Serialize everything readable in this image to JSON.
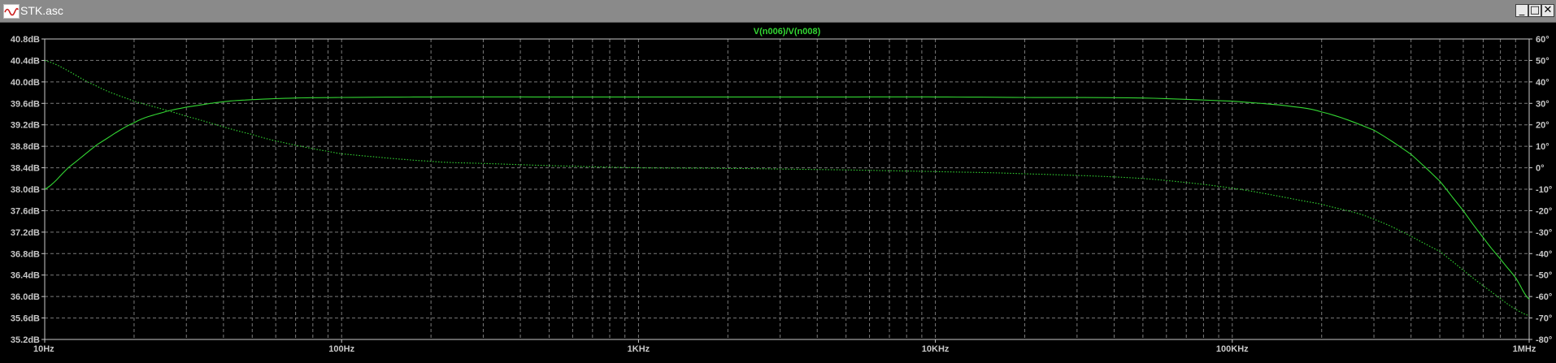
{
  "window": {
    "title": "STK.asc",
    "minimize_symbol": "_",
    "restore_symbol": "□",
    "close_symbol": "✕"
  },
  "colors": {
    "background": "#000000",
    "grid": "#7a7a7a",
    "trace": "#33d633",
    "trace_title": "#33d633",
    "axis_text": "#c8c8c8",
    "titlebar": "#8a8a8a"
  },
  "chart_data": {
    "type": "line",
    "title": "V(n006)/V(n008)",
    "x_scale": "log",
    "x_range": [
      10,
      1000000
    ],
    "x_ticks": [
      {
        "value": 10,
        "label": "10Hz"
      },
      {
        "value": 100,
        "label": "100Hz"
      },
      {
        "value": 1000,
        "label": "1KHz"
      },
      {
        "value": 10000,
        "label": "10KHz"
      },
      {
        "value": 100000,
        "label": "100KHz"
      },
      {
        "value": 1000000,
        "label": "1MHz"
      }
    ],
    "y_left": {
      "unit": "dB",
      "range": [
        35.2,
        40.8
      ],
      "ticks": [
        "35.2dB",
        "35.6dB",
        "36.0dB",
        "36.4dB",
        "36.8dB",
        "37.2dB",
        "37.6dB",
        "38.0dB",
        "38.4dB",
        "38.8dB",
        "39.2dB",
        "39.6dB",
        "40.0dB",
        "40.4dB",
        "40.8dB"
      ],
      "tick_values": [
        35.2,
        35.6,
        36.0,
        36.4,
        36.8,
        37.2,
        37.6,
        38.0,
        38.4,
        38.8,
        39.2,
        39.6,
        40.0,
        40.4,
        40.8
      ]
    },
    "y_right": {
      "unit": "°",
      "range": [
        -80,
        60
      ],
      "ticks": [
        "-80°",
        "-70°",
        "-60°",
        "-50°",
        "-40°",
        "-30°",
        "-20°",
        "-10°",
        "0°",
        "10°",
        "20°",
        "30°",
        "40°",
        "50°",
        "60°"
      ],
      "tick_values": [
        -80,
        -70,
        -60,
        -50,
        -40,
        -30,
        -20,
        -10,
        0,
        10,
        20,
        30,
        40,
        50,
        60
      ]
    },
    "grid": true,
    "series": [
      {
        "style": "solid",
        "axis": "left",
        "x": [
          10,
          12,
          15,
          20,
          25,
          30,
          40,
          50,
          70,
          100,
          200,
          500,
          1000,
          2000,
          5000,
          10000,
          20000,
          50000,
          100000,
          150000,
          200000,
          300000,
          400000,
          500000,
          600000,
          700000,
          800000,
          900000,
          1000000
        ],
        "values": [
          38.0,
          38.4,
          38.83,
          39.24,
          39.43,
          39.53,
          39.63,
          39.67,
          39.7,
          39.71,
          39.72,
          39.72,
          39.72,
          39.72,
          39.72,
          39.72,
          39.71,
          39.7,
          39.64,
          39.56,
          39.44,
          39.1,
          38.65,
          38.15,
          37.6,
          37.1,
          36.7,
          36.35,
          35.95
        ]
      },
      {
        "style": "dotted",
        "axis": "right",
        "x": [
          10,
          15,
          20,
          30,
          50,
          70,
          100,
          200,
          300,
          500,
          1000,
          2000,
          5000,
          10000,
          20000,
          50000,
          100000,
          200000,
          300000,
          500000,
          700000,
          1000000
        ],
        "values": [
          50,
          38,
          31,
          24,
          15.5,
          10.5,
          6.5,
          3,
          2,
          1,
          0,
          -0.3,
          -1,
          -1.8,
          -2.8,
          -5,
          -9.5,
          -17,
          -24,
          -39,
          -55,
          -69
        ]
      }
    ]
  }
}
